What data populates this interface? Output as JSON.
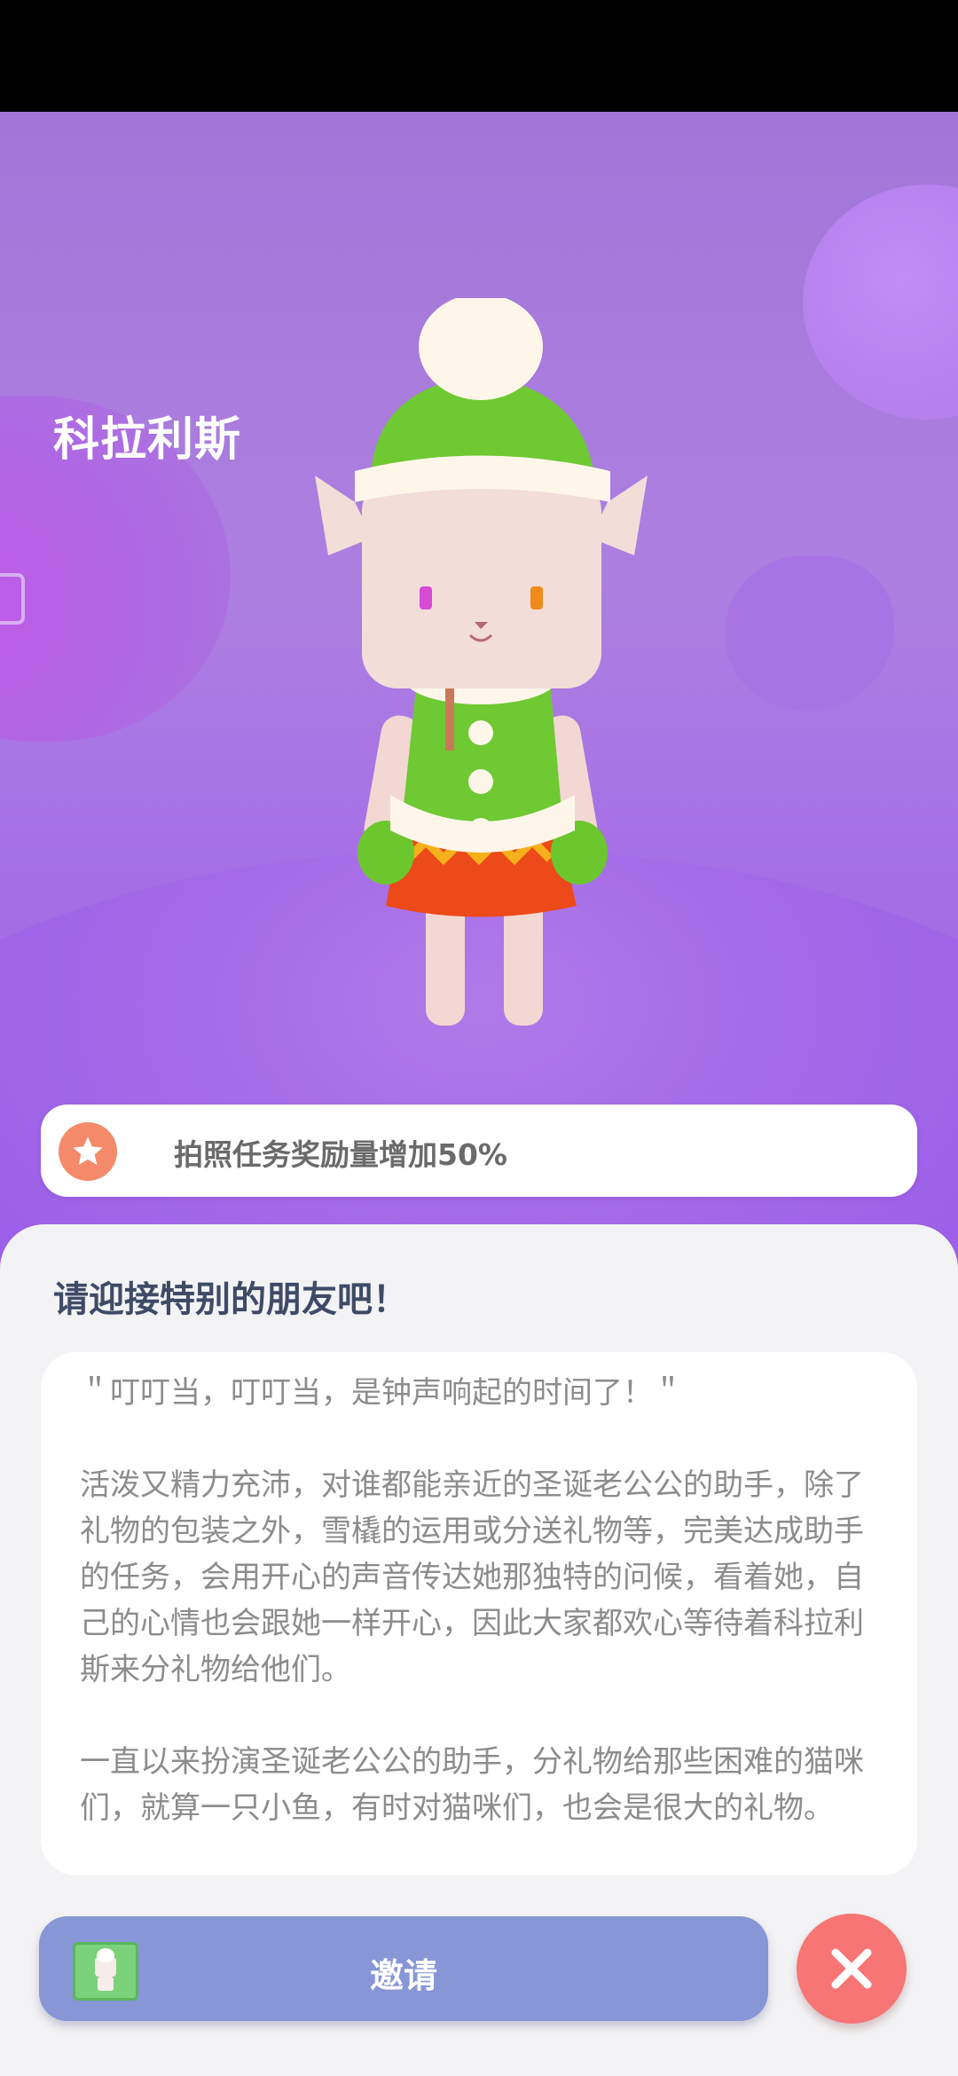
{
  "character": {
    "name": "科拉利斯"
  },
  "perk": {
    "icon": "star-icon",
    "text": "拍照任务奖励量增加50%",
    "accent": "#f58a6b"
  },
  "sheet": {
    "title": "请迎接特别的朋友吧！",
    "description": [
      "＂叮叮当，叮叮当，是钟声响起的时间了！＂",
      "活泼又精力充沛，对谁都能亲近的圣诞老公公的助手，除了礼物的包装之外，雪橇的运用或分送礼物等，完美达成助手的任务，会用开心的声音传达她那独特的问候，看着她，自己的心情也会跟她一样开心，因此大家都欢心等待着科拉利斯来分礼物给他们。",
      "一直以来扮演圣诞老公公的助手，分礼物给那些困难的猫咪们，就算一只小鱼，有时对猫咪们，也会是很大的礼物。"
    ]
  },
  "actions": {
    "invite_label": "邀请",
    "invite_color": "#8696d6",
    "close_icon": "close-icon",
    "close_color": "#f77575"
  },
  "theme": {
    "background": "#a66fe6",
    "sheet": "#f3f3f5"
  }
}
